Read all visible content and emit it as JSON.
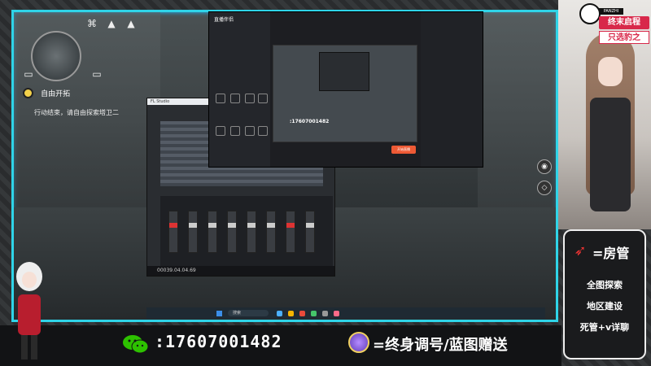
{
  "game": {
    "quest_title": "自由开拓",
    "quest_desc": "行动结束，请自由探索塔卫二"
  },
  "stream_app": {
    "logo": "直播伴侣",
    "start_label": "开始直播",
    "phone_in_preview": ":17607001482"
  },
  "daw": {
    "title": "FL Studio",
    "timecode": "00039.04.04.69"
  },
  "taskbar": {
    "search_placeholder": "搜索"
  },
  "banner": {
    "tag": "PANZHI",
    "line1": "终末启程",
    "line2": "只选豹之"
  },
  "infobox": {
    "line1": "=房管",
    "line2": "全图探索",
    "line3": "地区建设",
    "line4": "死管+v详聊"
  },
  "bottom": {
    "phone": ":17607001482",
    "promo": "=终身调号/蓝图赠送"
  },
  "colors": {
    "frame_cyan": "#2fd4e8",
    "accent_red": "#d8284a",
    "start_orange": "#ee5a35",
    "quest_yellow": "#f3d14a"
  }
}
